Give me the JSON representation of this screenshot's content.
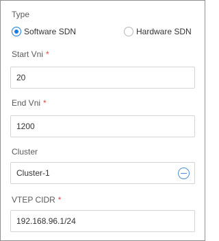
{
  "type": {
    "label": "Type",
    "options": [
      {
        "label": "Software SDN",
        "checked": true
      },
      {
        "label": "Hardware SDN",
        "checked": false
      }
    ]
  },
  "start_vni": {
    "label": "Start Vni",
    "required_mark": "*",
    "value": "20"
  },
  "end_vni": {
    "label": "End Vni",
    "required_mark": "*",
    "value": "1200"
  },
  "cluster": {
    "label": "Cluster",
    "value": "Cluster-1",
    "icon": "remove-circle-icon"
  },
  "vtep_cidr": {
    "label": "VTEP CIDR",
    "required_mark": "*",
    "value": "192.168.96.1/24"
  },
  "colors": {
    "accent": "#1a7be0",
    "required": "#e0443f",
    "border": "#d4d4d4"
  }
}
